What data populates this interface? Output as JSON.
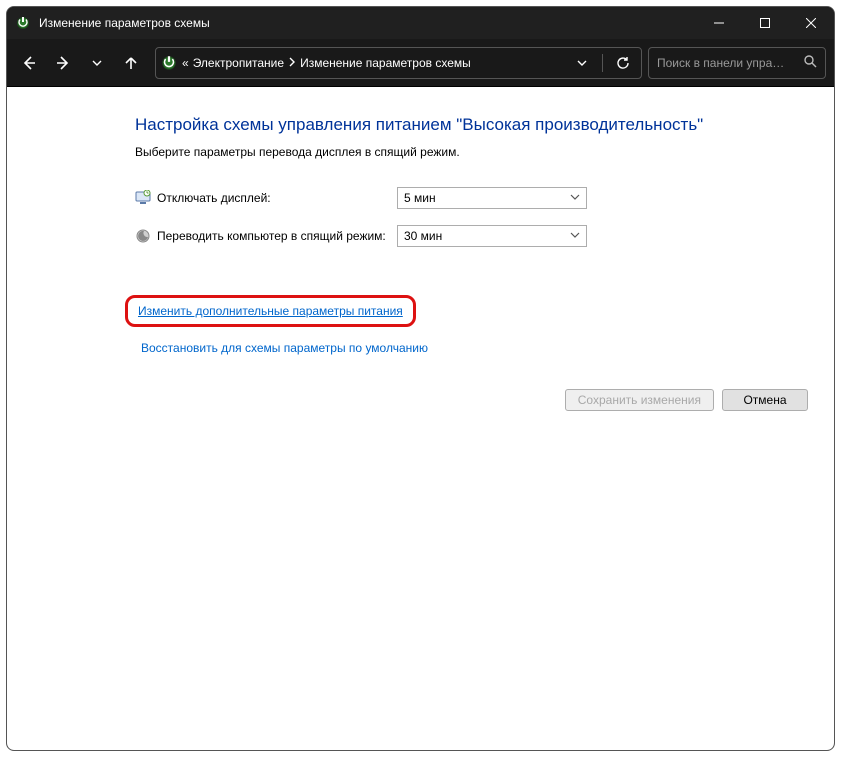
{
  "window": {
    "title": "Изменение параметров схемы"
  },
  "breadcrumb": {
    "prefix": "«",
    "item1": "Электропитание",
    "item2": "Изменение параметров схемы"
  },
  "search": {
    "placeholder": "Поиск в панели упра…"
  },
  "page": {
    "heading": "Настройка схемы управления питанием \"Высокая производительность\"",
    "instruction": "Выберите параметры перевода дисплея в спящий режим."
  },
  "settings": {
    "display_off_label": "Отключать дисплей:",
    "display_off_value": "5 мин",
    "sleep_label": "Переводить компьютер в спящий режим:",
    "sleep_value": "30 мин"
  },
  "links": {
    "advanced": "Изменить дополнительные параметры питания",
    "restore_defaults": "Восстановить для схемы параметры по умолчанию"
  },
  "buttons": {
    "save": "Сохранить изменения",
    "cancel": "Отмена"
  }
}
